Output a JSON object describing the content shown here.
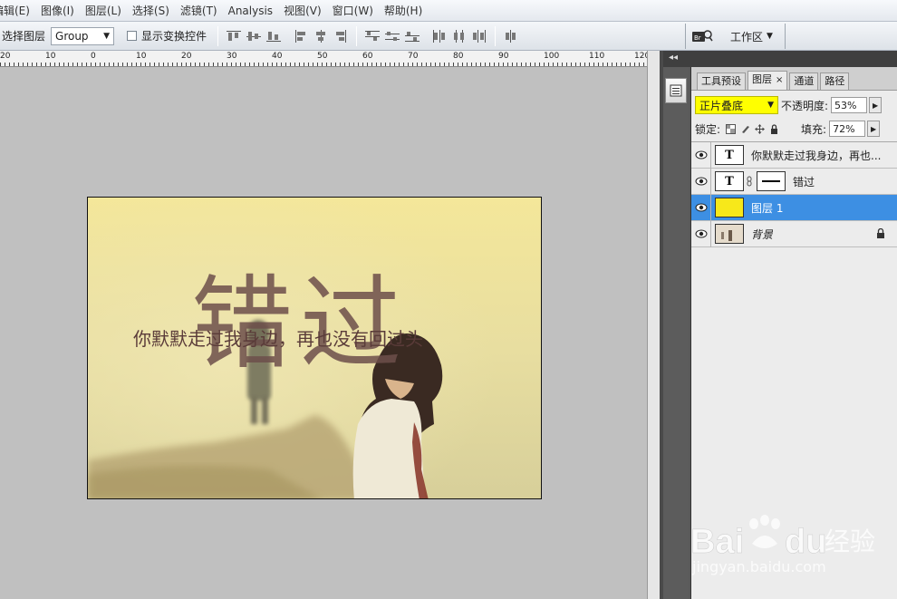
{
  "menubar": {
    "items": [
      "编辑(E)",
      "图像(I)",
      "图层(L)",
      "选择(S)",
      "滤镜(T)",
      "Analysis",
      "视图(V)",
      "窗口(W)",
      "帮助(H)"
    ]
  },
  "options": {
    "auto_select_label": "选择图层",
    "auto_select_value": "Group",
    "show_transform_label": "显示变换控件",
    "workspace_label": "工作区",
    "icons": [
      "align-top-icon",
      "align-vcenter-icon",
      "align-bottom-icon",
      "align-left-icon",
      "align-hcenter-icon",
      "align-right-icon",
      "distribute-top-icon",
      "distribute-vcenter-icon",
      "distribute-bottom-icon",
      "distribute-left-icon",
      "distribute-hcenter-icon",
      "distribute-right-icon",
      "auto-align-icon"
    ]
  },
  "ruler": {
    "labels": [
      "20",
      "10",
      "0",
      "10",
      "20",
      "30",
      "40",
      "50",
      "60",
      "70",
      "80",
      "90",
      "100",
      "110",
      "120"
    ]
  },
  "document": {
    "title_text": "错过",
    "subtitle_text": "你默默走过我身边，再也没有回过头"
  },
  "panel": {
    "tabs": [
      {
        "label": "工具预设",
        "active": false
      },
      {
        "label": "图层",
        "active": true,
        "close": "×"
      },
      {
        "label": "通道",
        "active": false
      },
      {
        "label": "路径",
        "active": false
      }
    ],
    "blend_mode": "正片叠底",
    "opacity_label": "不透明度:",
    "opacity_value": "53%",
    "lock_label": "锁定:",
    "fill_label": "填充:",
    "fill_value": "72%",
    "layers": [
      {
        "name": "你默默走过我身边，再也...",
        "type": "text",
        "thumb_label": "T",
        "selected": false
      },
      {
        "name": "错过",
        "type": "text-masked",
        "thumb_label": "T",
        "selected": false
      },
      {
        "name": "图层 1",
        "type": "fill",
        "selected": true,
        "fill_color": "#f7e81a"
      },
      {
        "name": "背景",
        "type": "background",
        "selected": false,
        "locked": true
      }
    ]
  },
  "watermark": {
    "brand": "Bai",
    "brand2": "du",
    "cn": "经验",
    "url": "jingyan.baidu.com"
  },
  "colors": {
    "accent_selected": "#3d8fe3",
    "blend_highlight": "#ffff00",
    "canvas_bg": "#c0c0c0",
    "text_overlay": "#6d4f4b"
  }
}
